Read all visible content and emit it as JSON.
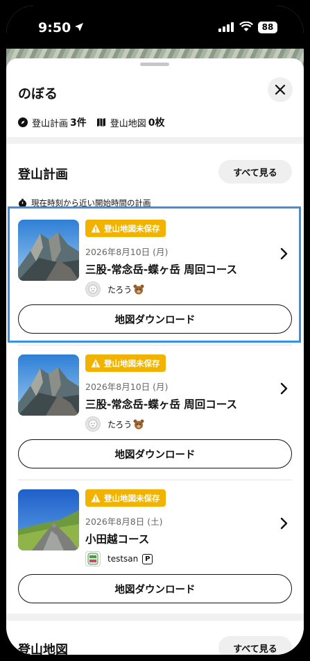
{
  "status_bar": {
    "time": "9:50",
    "battery": "88"
  },
  "sheet": {
    "title": "のぼる",
    "stats": {
      "plans_label": "登山計画",
      "plans_count": "3件",
      "maps_label": "登山地図",
      "maps_count": "0枚"
    }
  },
  "plans_section": {
    "title": "登山計画",
    "see_all": "すべて見る",
    "note": "現在時刻から近い開始時間の計画",
    "cards": [
      {
        "badge": "登山地図未保存",
        "date": "2026年8月10日 (月)",
        "title": "三股-常念岳-蝶ヶ岳 周回コース",
        "user": "たろう",
        "download": "地図ダウンロード",
        "thumb": "mountain-ridge"
      },
      {
        "badge": "登山地図未保存",
        "date": "2026年8月10日 (月)",
        "title": "三股-常念岳-蝶ヶ岳 周回コース",
        "user": "たろう",
        "download": "地図ダウンロード",
        "thumb": "mountain-ridge"
      },
      {
        "badge": "登山地図未保存",
        "date": "2026年8月8日 (土)",
        "title": "小田越コース",
        "user": "testsan",
        "download": "地図ダウンロード",
        "thumb": "rocky-summit"
      }
    ]
  },
  "maps_section": {
    "title": "登山地図",
    "see_all": "すべて見る"
  },
  "colors": {
    "badge": "#f2b300",
    "highlight": "#3d8fe0"
  }
}
